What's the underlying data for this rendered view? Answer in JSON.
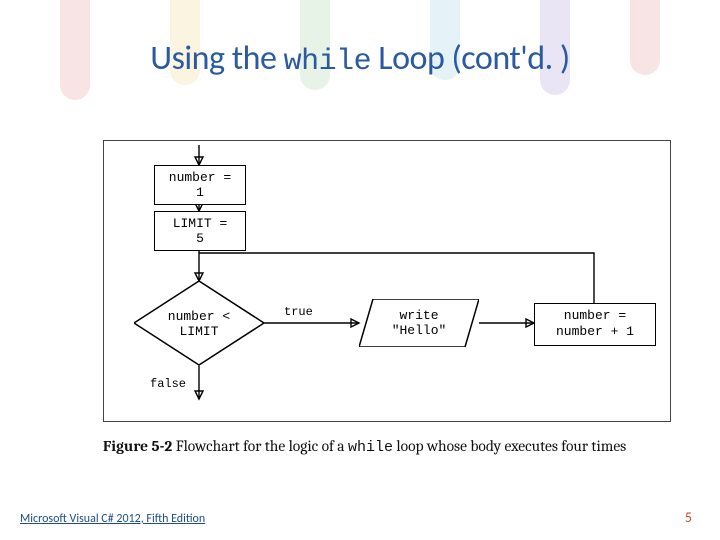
{
  "title": {
    "pre": "Using the ",
    "code": "while",
    "post": " Loop (cont'd. )"
  },
  "flowchart": {
    "init1": "number = 1",
    "init2": "LIMIT = 5",
    "decision_line1": "number <",
    "decision_line2": "LIMIT",
    "true_label": "true",
    "false_label": "false",
    "io_line1": "write",
    "io_line2": "\"Hello\"",
    "update_line1": "number =",
    "update_line2": "number + 1"
  },
  "caption": {
    "prefix_bold": "Figure 5-2",
    "mid1": "  Flowchart for the logic of a ",
    "code": "while",
    "mid2": " loop whose body executes four times"
  },
  "footer": "Microsoft Visual C# 2012, Fifth Edition",
  "page": "5",
  "decor_colors": [
    "#d66b6b",
    "#e8c25b",
    "#7fbf7f",
    "#6fb7d6",
    "#8f74c8",
    "#d66b6b"
  ]
}
